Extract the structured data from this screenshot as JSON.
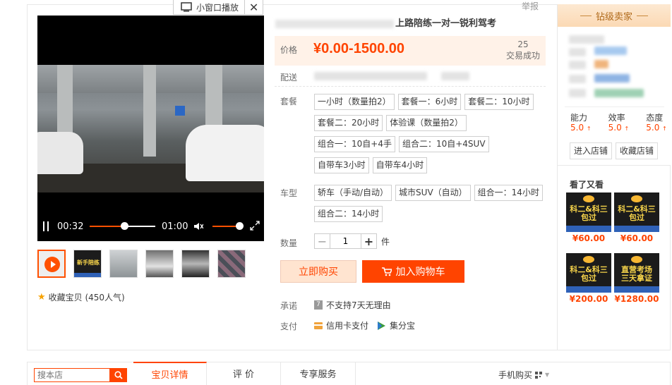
{
  "pip": {
    "label": "小窗口播放",
    "close": "✕"
  },
  "report": "举报",
  "title": {
    "text": "上路陪练一对一锐利驾考"
  },
  "price": {
    "label": "价格",
    "value": "¥0.00-1500.00",
    "sold_count": "25",
    "sold_label": "交易成功"
  },
  "delivery": {
    "label": "配送"
  },
  "package": {
    "label": "套餐",
    "options": [
      "一小时（数量拍2）",
      "套餐一：6小时",
      "套餐二：10小时",
      "套餐二：20小时",
      "体验课（数量拍2）",
      "组合一：10自+4手",
      "组合二：10自+4SUV",
      "自带车3小时",
      "自带车4小时"
    ]
  },
  "car_type": {
    "label": "车型",
    "options": [
      "轿车（手动/自动）",
      "城市SUV（自动）",
      "组合一：14小时",
      "组合二：14小时"
    ]
  },
  "quantity": {
    "label": "数量",
    "value": "1",
    "unit": "件",
    "minus": "−",
    "plus": "+"
  },
  "buttons": {
    "buy_now": "立即购买",
    "add_cart": "加入购物车"
  },
  "promise": {
    "label": "承诺",
    "icon_text": "7",
    "text": "不支持7天无理由"
  },
  "payment": {
    "label": "支付",
    "credit": "信用卡支付",
    "jifen": "集分宝"
  },
  "video": {
    "current_time": "00:32",
    "total_time": "01:00",
    "progress": 0.53,
    "volume": 0.9
  },
  "favorite": {
    "text": "收藏宝贝 (450人气)"
  },
  "seller": {
    "badge": "钻级卖家",
    "ratings": [
      {
        "label": "能力",
        "value": "5.0"
      },
      {
        "label": "效率",
        "value": "5.0"
      },
      {
        "label": "态度",
        "value": "5.0"
      }
    ],
    "enter_shop": "进入店铺",
    "fav_shop": "收藏店铺"
  },
  "also_viewed": {
    "title": "看了又看",
    "items": [
      {
        "text": "科二&科三\n包过",
        "price": "¥60.00"
      },
      {
        "text": "科二&科三\n包过",
        "price": "¥60.00"
      },
      {
        "text": "科二&科三\n包过",
        "price": "¥200.00"
      },
      {
        "text": "直营考场\n三天拿证",
        "price": "¥1280.00"
      }
    ]
  },
  "thumb_labels": [
    "新手陪练"
  ],
  "bottom": {
    "search_placeholder": "搜本店",
    "tabs": [
      "宝贝详情",
      "评 价",
      "专享服务"
    ],
    "mobile": "手机购买"
  },
  "colors": {
    "accent": "#ff4400",
    "price_bg": "#fff2e8"
  }
}
